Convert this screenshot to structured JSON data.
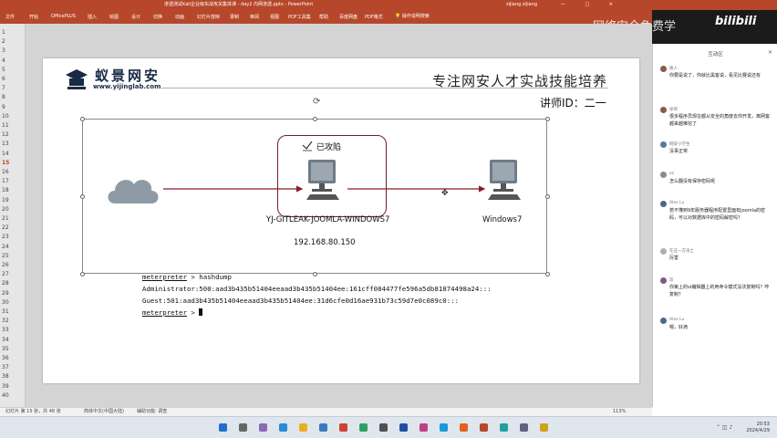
{
  "window": {
    "title": "渗透测试Kali企业级实战攻关集体课 - day2 内网渗透.pptx - PowerPoint",
    "user": "zijiang zijiang",
    "controls": "—  □  ✕"
  },
  "ribbon": {
    "tabs": [
      "文件",
      "开始",
      "OfficePLUS",
      "插入",
      "绘图",
      "设计",
      "切换",
      "动画",
      "幻灯片放映",
      "录制",
      "审阅",
      "视图",
      "PDF工具集",
      "帮助",
      "百度网盘",
      "PDF格式"
    ],
    "search": "操作说明搜索"
  },
  "overlay": {
    "watermark": "网络安全免费学",
    "bilibili": "bilibili"
  },
  "slide_numbers": [
    "1",
    "2",
    "3",
    "4",
    "5",
    "6",
    "7",
    "8",
    "9",
    "10",
    "11",
    "12",
    "13",
    "14",
    "15",
    "16",
    "17",
    "18",
    "19",
    "20",
    "21",
    "22",
    "23",
    "24",
    "25",
    "26",
    "27",
    "28",
    "29",
    "30",
    "31",
    "32",
    "33",
    "34",
    "35",
    "36",
    "37",
    "38",
    "39",
    "40"
  ],
  "active_slide": "15",
  "slide": {
    "logo_name": "蚁景网安",
    "logo_url": "www.yijinglab.com",
    "heading": "专注网安人才实战技能培养",
    "teacher": "讲师ID：二一",
    "attacked_label": "已攻陷",
    "host1": "YJ-GITLEAK-JOOMLA-WINDOWS7",
    "host2": "Windows7",
    "ip": "192.168.80.150",
    "terminal": {
      "prompt_word": "meterpreter",
      "cmd_line": " > hashdump",
      "line1": "Administrator:500:aad3b435b51404eeaad3b435b51404ee:161cff084477fe596a5db81874498a24:::",
      "line2": "Guest:501:aad3b435b51404eeaad3b435b51404ee:31d6cfe0d16ae931b73c59d7e0c089c0:::",
      "prompt_end": " > "
    }
  },
  "chat": {
    "tab": "互动区",
    "close": "✕",
    "messages": [
      {
        "name": "路人",
        "text": "你要是说了，你就比黑客说，看见比赛说还有"
      },
      {
        "name": "徐哥",
        "text": "很多程序员现在都从安全的角度去你开发，离网客越来越难挖了"
      },
      {
        "name": "网安小学生",
        "text": "没事正常"
      },
      {
        "name": "ez",
        "text": "怎么翻没有保存密码呢"
      },
      {
        "name": "Alex Lu",
        "text": "若不懂到9年服务器程序配置里面有joomla的密码，可以对数据库中的密码解密吗？"
      },
      {
        "name": "在这一方净土",
        "text": "厉害"
      },
      {
        "name": "双",
        "text": "你第上的vi编辑器上的用命令模式没法复制吗？咋复制？"
      },
      {
        "name": "Alex Lu",
        "text": "嗯，好滴"
      }
    ]
  },
  "status": {
    "slide_info": "幻灯片 第 15 张，共 48 张",
    "language": "简体中文(中国大陆)",
    "accessibility": "辅助功能: 调查",
    "zoom": "113%"
  },
  "taskbar": {
    "time": "20:53",
    "date": "2024/4/29"
  }
}
